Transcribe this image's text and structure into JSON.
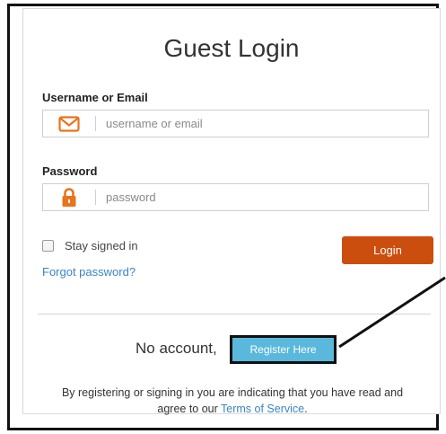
{
  "form": {
    "title": "Guest Login",
    "username_label": "Username or Email",
    "username_placeholder": "username or email",
    "password_label": "Password",
    "password_placeholder": "password",
    "stay_signed_in_label": "Stay signed in",
    "login_label": "Login",
    "forgot_label": "Forgot password?"
  },
  "register": {
    "prompt": "No account,",
    "button_label": "Register Here"
  },
  "terms": {
    "text_line1": "By registering or signing in you are indicating that you have read and",
    "text_line2_pre": "agree to our ",
    "link_label": "Terms of Service",
    "text_line2_post": "."
  },
  "colors": {
    "accent_orange": "#cc4e0e",
    "icon_orange": "#e8741e",
    "link_blue": "#3a85c6",
    "register_blue": "#5ab8dc"
  },
  "icons": {
    "username": "envelope-icon",
    "password": "lock-icon"
  }
}
